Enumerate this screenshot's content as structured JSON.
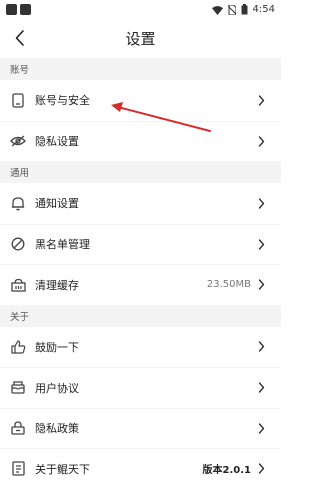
{
  "status_bar": {
    "time": "4:54"
  },
  "header": {
    "title": "设置"
  },
  "sections": {
    "account": {
      "title": "账号"
    },
    "general": {
      "title": "通用"
    },
    "about": {
      "title": "关于"
    }
  },
  "items": {
    "account_security": {
      "label": "账号与安全",
      "icon": "phone-icon"
    },
    "privacy_settings": {
      "label": "隐私设置",
      "icon": "eye-off-icon"
    },
    "notification_settings": {
      "label": "通知设置",
      "icon": "bell-icon"
    },
    "blacklist": {
      "label": "黑名单管理",
      "icon": "block-icon"
    },
    "clear_cache": {
      "label": "清理缓存",
      "value": "23.50MB",
      "icon": "cleaner-icon"
    },
    "encourage": {
      "label": "鼓励一下",
      "icon": "thumbs-up-icon"
    },
    "user_agreement": {
      "label": "用户协议",
      "icon": "mailbox-icon"
    },
    "privacy_policy": {
      "label": "隐私政策",
      "icon": "lock-icon"
    },
    "about": {
      "label": "关于鲲天下",
      "value": "版本2.0.1",
      "icon": "info-list-icon"
    }
  },
  "colors": {
    "annotation_arrow": "#d62b2b",
    "section_bg": "#f4f4f4"
  }
}
